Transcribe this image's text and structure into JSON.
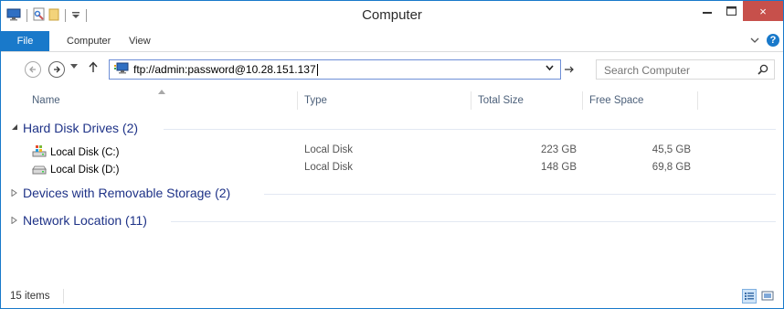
{
  "window": {
    "title": "Computer",
    "close_glyph": "×",
    "accent_color": "#1979ca",
    "close_color": "#c7504b"
  },
  "ribbon": {
    "tabs": [
      "File",
      "Computer",
      "View"
    ],
    "help_glyph": "?"
  },
  "nav": {
    "address": "ftp://admin:password@10.28.151.137",
    "search_placeholder": "Search Computer"
  },
  "columns": {
    "name": "Name",
    "type": "Type",
    "total_size": "Total Size",
    "free_space": "Free Space"
  },
  "groups": [
    {
      "label": "Hard Disk Drives (2)",
      "expanded": true,
      "items": [
        {
          "name": "Local Disk (C:)",
          "type": "Local Disk",
          "total": "223 GB",
          "free": "45,5 GB",
          "icon": "windows-drive-icon"
        },
        {
          "name": "Local Disk (D:)",
          "type": "Local Disk",
          "total": "148 GB",
          "free": "69,8 GB",
          "icon": "drive-icon"
        }
      ]
    },
    {
      "label": "Devices with Removable Storage (2)",
      "expanded": false
    },
    {
      "label": "Network Location (11)",
      "expanded": false
    }
  ],
  "status": {
    "item_count": "15 items"
  }
}
